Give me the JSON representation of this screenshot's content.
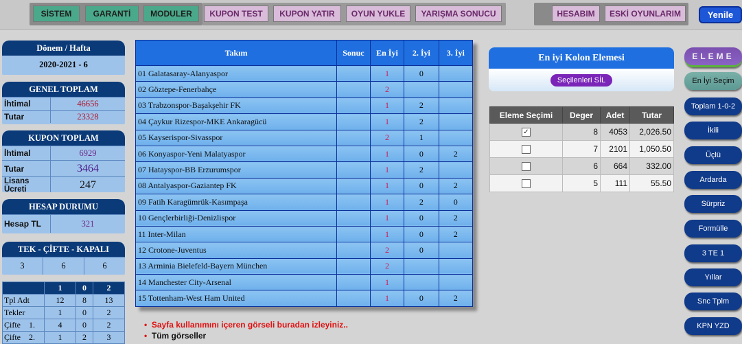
{
  "topnav": {
    "sistem": "SİSTEM",
    "garanti": "GARANTİ",
    "moduler": "MODULER",
    "kupon_test": "KUPON TEST",
    "kupon_yatir": "KUPON YATIR",
    "oyun_yukle": "OYUN YUKLE",
    "yarisma_sonucu": "YARIŞMA SONUCU",
    "hesabim": "HESABIM",
    "eski_oyunlarim": "ESKİ OYUNLARIM",
    "yenile": "Yenile"
  },
  "donem": {
    "title": "Dönem / Hafta",
    "value": "2020-2021 - 6"
  },
  "genel_toplam": {
    "title": "GENEL TOPLAM",
    "ihtimal_label": "İhtimal",
    "ihtimal": "46656",
    "tutar_label": "Tutar",
    "tutar": "23328"
  },
  "kupon_toplam": {
    "title": "KUPON TOPLAM",
    "ihtimal_label": "İhtimal",
    "ihtimal": "6929",
    "tutar_label": "Tutar",
    "tutar": "3464",
    "lisans_label": "Lisans Ücreti",
    "lisans": "247"
  },
  "hesap_durumu": {
    "title": "HESAP DURUMU",
    "label": "Hesap TL",
    "value": "321"
  },
  "tek_cifte": {
    "title": "TEK - ÇİFTE - KAPALI",
    "values": [
      "3",
      "6",
      "6"
    ]
  },
  "stats": {
    "headers": [
      "",
      "1",
      "0",
      "2"
    ],
    "rows": [
      [
        "Tpl Adt",
        "12",
        "8",
        "13"
      ],
      [
        "Tekler",
        "1",
        "0",
        "2"
      ],
      [
        "Çifte    1.",
        "4",
        "0",
        "2"
      ],
      [
        "Çifte    2.",
        "1",
        "2",
        "3"
      ]
    ]
  },
  "matches": {
    "headers": {
      "takim": "Takım",
      "sonuc": "Sonuc",
      "en_iyi": "En İyi",
      "iyi2": "2. İyi",
      "iyi3": "3. İyi"
    },
    "rows": [
      {
        "team": "01 Galatasaray-Alanyaspor",
        "sonuc": "",
        "en": "1",
        "i2": "0",
        "i3": ""
      },
      {
        "team": "02 Göztepe-Fenerbahçe",
        "sonuc": "",
        "en": "2",
        "i2": "",
        "i3": ""
      },
      {
        "team": "03 Trabzonspor-Başakşehir FK",
        "sonuc": "",
        "en": "1",
        "i2": "2",
        "i3": ""
      },
      {
        "team": "04 Çaykur Rizespor-MKE Ankaragücü",
        "sonuc": "",
        "en": "1",
        "i2": "2",
        "i3": ""
      },
      {
        "team": "05 Kayserispor-Sivasspor",
        "sonuc": "",
        "en": "2",
        "i2": "1",
        "i3": ""
      },
      {
        "team": "06 Konyaspor-Yeni Malatyaspor",
        "sonuc": "",
        "en": "1",
        "i2": "0",
        "i3": "2"
      },
      {
        "team": "07 Hatayspor-BB Erzurumspor",
        "sonuc": "",
        "en": "1",
        "i2": "2",
        "i3": ""
      },
      {
        "team": "08 Antalyaspor-Gaziantep FK",
        "sonuc": "",
        "en": "1",
        "i2": "0",
        "i3": "2"
      },
      {
        "team": "09 Fatih Karagümrük-Kasımpaşa",
        "sonuc": "",
        "en": "1",
        "i2": "2",
        "i3": "0"
      },
      {
        "team": "10 Gençlerbirliği-Denizlispor",
        "sonuc": "",
        "en": "1",
        "i2": "0",
        "i3": "2"
      },
      {
        "team": "11 Inter-Milan",
        "sonuc": "",
        "en": "1",
        "i2": "0",
        "i3": "2"
      },
      {
        "team": "12 Crotone-Juventus",
        "sonuc": "",
        "en": "2",
        "i2": "0",
        "i3": ""
      },
      {
        "team": "13 Arminia Bielefeld-Bayern München",
        "sonuc": "",
        "en": "2",
        "i2": "",
        "i3": ""
      },
      {
        "team": "14 Manchester City-Arsenal",
        "sonuc": "",
        "en": "1",
        "i2": "",
        "i3": ""
      },
      {
        "team": "15 Tottenham-West Ham United",
        "sonuc": "",
        "en": "1",
        "i2": "0",
        "i3": "2"
      }
    ]
  },
  "kolon": {
    "title": "En iyi Kolon Elemesi",
    "button": "Seçilenleri SİL"
  },
  "eleme_table": {
    "headers": [
      "Eleme Seçimi",
      "Deger",
      "Adet",
      "Tutar"
    ],
    "rows": [
      {
        "checked": "✓",
        "deger": "8",
        "adet": "4053",
        "tutar": "2,026.50"
      },
      {
        "checked": "",
        "deger": "7",
        "adet": "2101",
        "tutar": "1,050.50"
      },
      {
        "checked": "",
        "deger": "6",
        "adet": "664",
        "tutar": "332.00"
      },
      {
        "checked": "",
        "deger": "5",
        "adet": "111",
        "tutar": "55.50"
      }
    ]
  },
  "right_buttons": {
    "eleme": "ELEME",
    "en_iyi_secim": "En İyi Seçim",
    "toplam": "Toplam 1-0-2",
    "ikili": "İkili",
    "uclu": "Üçlü",
    "ardarda": "Ardarda",
    "surpriz": "Sürpriz",
    "formulle": "Formülle",
    "te1": "3 TE 1",
    "yillar": "Yıllar",
    "snc_tplm": "Snc Tplm",
    "kpn_yzd": "KPN YZD"
  },
  "notes": {
    "gorsel": "Sayfa kullanımını içeren görseli buradan izleyiniz..",
    "tum": "Tüm görseller"
  }
}
